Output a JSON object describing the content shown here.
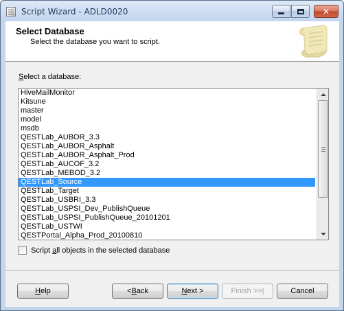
{
  "window": {
    "title": "Script Wizard - ADLD0020",
    "close_glyph": "✕"
  },
  "header": {
    "title": "Select Database",
    "subtitle": "Select the database you want to script."
  },
  "database_list": {
    "label_mnemonic": "S",
    "label_rest": "elect a database:",
    "items": [
      "HiveMailMonitor",
      "Kitsune",
      "master",
      "model",
      "msdb",
      "QESTLab_AUBOR_3.3",
      "QESTLab_AUBOR_Asphalt",
      "QESTLab_AUBOR_Asphalt_Prod",
      "QESTLab_AUCOF_3.2",
      "QESTLab_MEBOD_3.2",
      "QESTLab_Source",
      "QESTLab_Target",
      "QESTLab_USBRI_3.3",
      "QESTLab_USPSI_Dev_PublishQueue",
      "QESTLab_USPSI_PublishQueue_20101201",
      "QESTLab_USTWI",
      "QESTPortal_Alpha_Prod_20100810"
    ],
    "selected": "QESTLab_Source"
  },
  "script_all": {
    "label_before": "Script ",
    "label_mnemonic": "a",
    "label_after": "ll objects in the selected database",
    "checked": false
  },
  "buttons": {
    "help": {
      "mnemonic": "H",
      "rest": "elp"
    },
    "back": {
      "prefix": "< ",
      "mnemonic": "B",
      "rest": "ack"
    },
    "next": {
      "mnemonic": "N",
      "rest": "ext >"
    },
    "finish": {
      "label": "Finish >>|"
    },
    "cancel": {
      "label": "Cancel"
    }
  },
  "icons": {
    "window": "script-document-icon",
    "header": "parchment-scroll-icon",
    "minimize": "minimize-icon",
    "maximize": "maximize-icon",
    "close": "close-icon"
  },
  "colors": {
    "selection": "#3399ff",
    "titlebar": "#c4d6ec",
    "close_button": "#c0472b"
  }
}
